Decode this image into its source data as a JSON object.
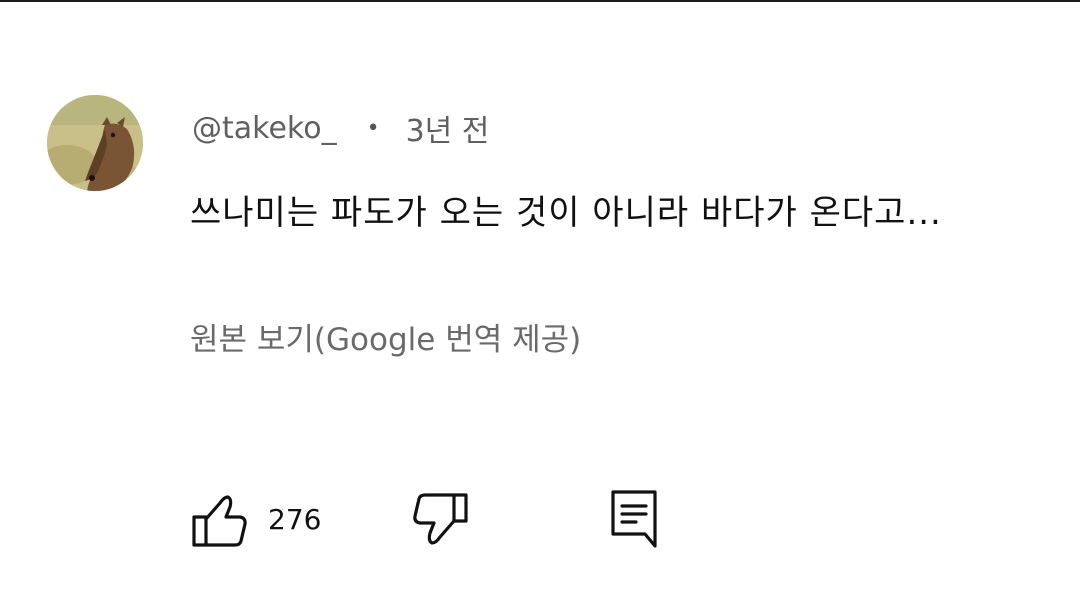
{
  "comment": {
    "author": "@takeko_",
    "separator": "•",
    "timestamp": "3년 전",
    "text": "쓰나미는 파도가 오는 것이 아니라 바다가 온다고...",
    "translate_link": "원본 보기(Google 번역 제공)"
  },
  "actions": {
    "like_count": "276",
    "like_icon": "thumbs-up-icon",
    "dislike_icon": "thumbs-down-icon",
    "reply_icon": "reply-comment-icon"
  },
  "colors": {
    "meta_text": "#606060",
    "link_text": "#6a6a6a",
    "primary_text": "#111111"
  }
}
